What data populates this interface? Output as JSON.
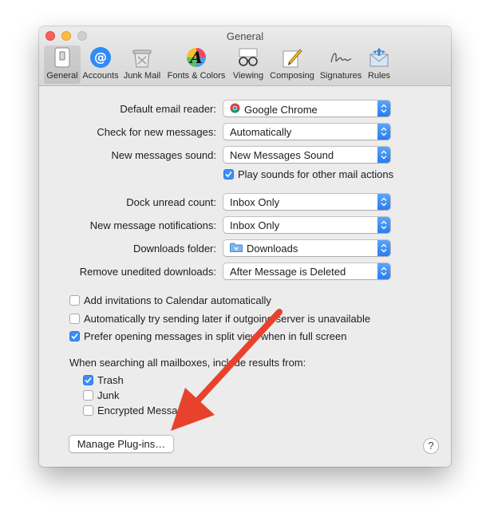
{
  "window": {
    "title": "General"
  },
  "toolbar": {
    "items": [
      {
        "label": "General",
        "icon": "general-switch-icon"
      },
      {
        "label": "Accounts",
        "icon": "accounts-at-icon"
      },
      {
        "label": "Junk Mail",
        "icon": "junk-mail-trash-icon"
      },
      {
        "label": "Fonts & Colors",
        "icon": "fonts-colors-icon"
      },
      {
        "label": "Viewing",
        "icon": "viewing-glasses-icon"
      },
      {
        "label": "Composing",
        "icon": "composing-pencil-icon"
      },
      {
        "label": "Signatures",
        "icon": "signature-icon"
      },
      {
        "label": "Rules",
        "icon": "rules-envelope-icon"
      }
    ],
    "selected": "General"
  },
  "settings": {
    "default_reader": {
      "label": "Default email reader:",
      "value": "Google Chrome"
    },
    "check_messages": {
      "label": "Check for new messages:",
      "value": "Automatically"
    },
    "messages_sound": {
      "label": "New messages sound:",
      "value": "New Messages Sound"
    },
    "play_sounds": {
      "label": "Play sounds for other mail actions",
      "checked": true
    },
    "dock_unread": {
      "label": "Dock unread count:",
      "value": "Inbox Only"
    },
    "notifications": {
      "label": "New message notifications:",
      "value": "Inbox Only"
    },
    "downloads_folder": {
      "label": "Downloads folder:",
      "value": "Downloads"
    },
    "remove_downloads": {
      "label": "Remove unedited downloads:",
      "value": "After Message is Deleted"
    }
  },
  "options": {
    "add_invitations": {
      "label": "Add invitations to Calendar automatically",
      "checked": false
    },
    "try_sending_later": {
      "label": "Automatically try sending later if outgoing server is unavailable",
      "checked": false
    },
    "split_view": {
      "label": "Prefer opening messages in split view when in full screen",
      "checked": true
    }
  },
  "search": {
    "heading": "When searching all mailboxes, include results from:",
    "trash": {
      "label": "Trash",
      "checked": true
    },
    "junk": {
      "label": "Junk",
      "checked": false
    },
    "encrypted": {
      "label": "Encrypted Messages",
      "checked": false
    }
  },
  "buttons": {
    "manage_plugins": "Manage Plug-ins…",
    "help": "?"
  },
  "colors": {
    "accent": "#3b8df7",
    "annotation_arrow": "#e8412c"
  }
}
